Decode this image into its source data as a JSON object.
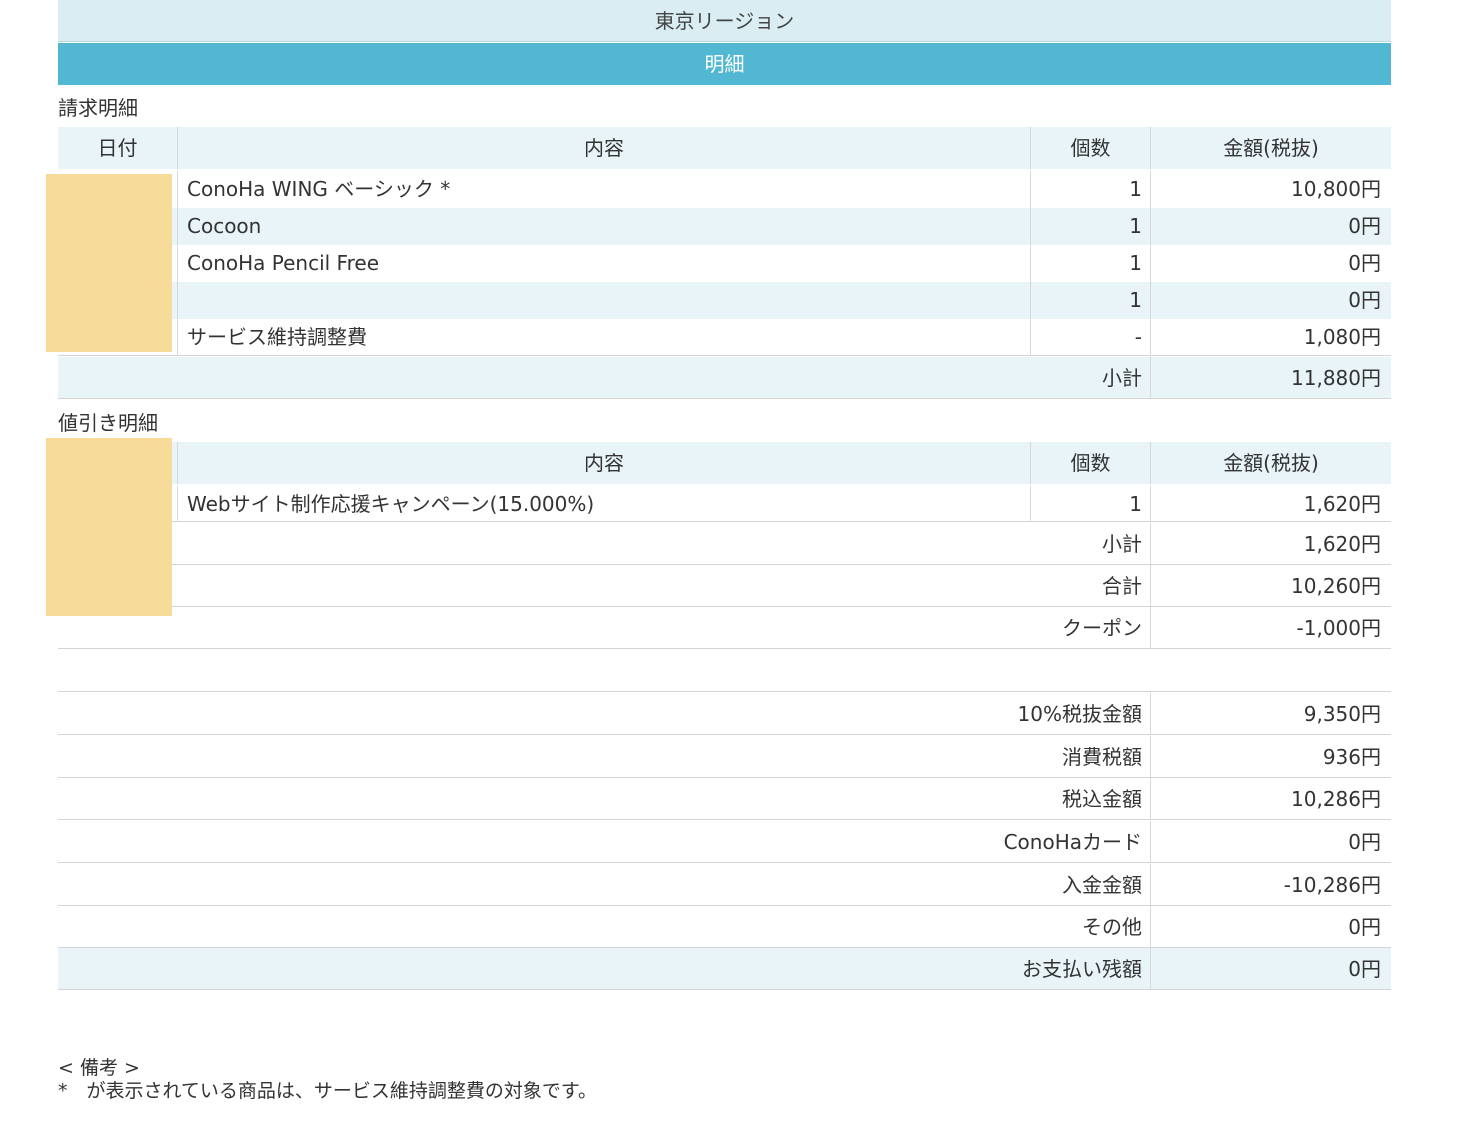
{
  "region_title": "東京リージョン",
  "detail_title": "明細",
  "billing": {
    "section_label": "請求明細",
    "headers": {
      "date": "日付",
      "description": "内容",
      "quantity": "個数",
      "amount": "金額(税抜)"
    },
    "items": [
      {
        "description": "ConoHa WING ベーシック *",
        "quantity": "1",
        "amount": "10,800円"
      },
      {
        "description": "Cocoon",
        "quantity": "1",
        "amount": "0円"
      },
      {
        "description": "ConoHa Pencil Free",
        "quantity": "1",
        "amount": "0円"
      },
      {
        "description": "",
        "quantity": "1",
        "amount": "0円"
      },
      {
        "description": "サービス維持調整費",
        "quantity": "-",
        "amount": "1,080円"
      }
    ],
    "subtotal_label": "小計",
    "subtotal_value": "11,880円"
  },
  "discount": {
    "section_label": "値引き明細",
    "headers": {
      "description": "内容",
      "quantity": "個数",
      "amount": "金額(税抜)"
    },
    "items": [
      {
        "description": "Webサイト制作応援キャンペーン(15.000%)",
        "quantity": "1",
        "amount": "1,620円"
      }
    ],
    "subtotal_label": "小計",
    "subtotal_value": "1,620円"
  },
  "totals": {
    "total_label": "合計",
    "total_value": "10,260円",
    "coupon_label": "クーポン",
    "coupon_value": "-1,000円"
  },
  "tax": [
    {
      "label": "10%税抜金額",
      "value": "9,350円"
    },
    {
      "label": "消費税額",
      "value": "936円"
    },
    {
      "label": "税込金額",
      "value": "10,286円"
    },
    {
      "label": "ConoHaカード",
      "value": "0円"
    },
    {
      "label": "入金金額",
      "value": "-10,286円"
    },
    {
      "label": "その他",
      "value": "0円"
    },
    {
      "label": "お支払い残額",
      "value": "0円"
    }
  ],
  "notes": {
    "heading": "< 備考 >",
    "line1": "*　が表示されている商品は、サービス維持調整費の対象です。"
  },
  "colors": {
    "header_band": "#52b7d3",
    "region_band": "#d9edf3",
    "row_alt": "#e8f4f8",
    "redaction": "#f7db99"
  }
}
